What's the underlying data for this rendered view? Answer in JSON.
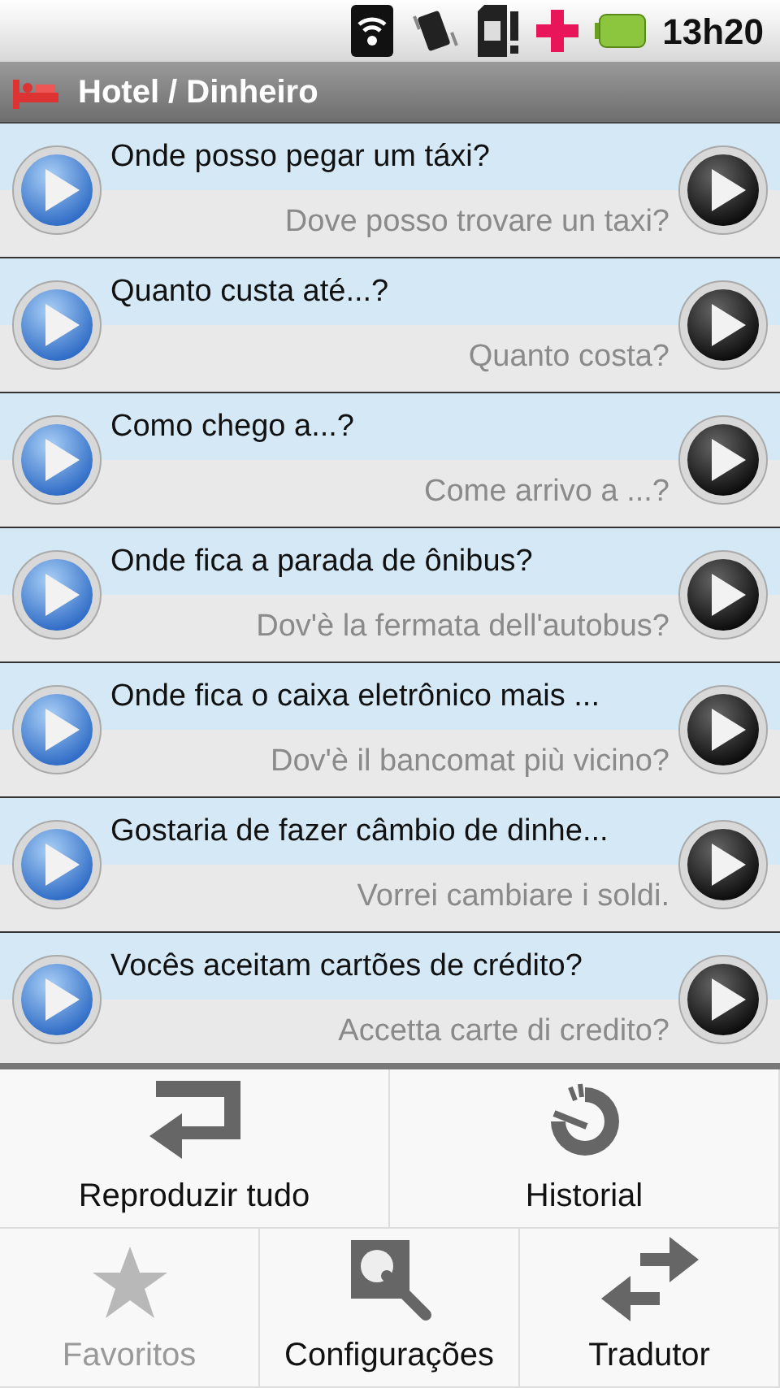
{
  "status_bar": {
    "time": "13h20"
  },
  "title_bar": {
    "title": "Hotel / Dinheiro"
  },
  "phrases": [
    {
      "source": "Onde posso pegar um táxi?",
      "translation": "Dove posso trovare un taxi?"
    },
    {
      "source": "Quanto custa até...?",
      "translation": "Quanto costa?"
    },
    {
      "source": "Como chego a...?",
      "translation": "Come arrivo a ...?"
    },
    {
      "source": "Onde fica a parada de ônibus?",
      "translation": "Dov'è la fermata dell'autobus?"
    },
    {
      "source": "Onde fica o caixa eletrônico mais ...",
      "translation": "Dov'è il bancomat più vicino?"
    },
    {
      "source": "Gostaria de fazer câmbio de dinhe...",
      "translation": "Vorrei cambiare i soldi."
    },
    {
      "source": "Vocês aceitam cartões de crédito?",
      "translation": "Accetta carte di credito?"
    }
  ],
  "menu": {
    "rows": [
      [
        {
          "label": "Reproduzir tudo",
          "disabled": false
        },
        {
          "label": "Historial",
          "disabled": false
        }
      ],
      [
        {
          "label": "Favoritos",
          "disabled": true
        },
        {
          "label": "Configurações",
          "disabled": false
        },
        {
          "label": "Tradutor",
          "disabled": false
        }
      ]
    ]
  }
}
